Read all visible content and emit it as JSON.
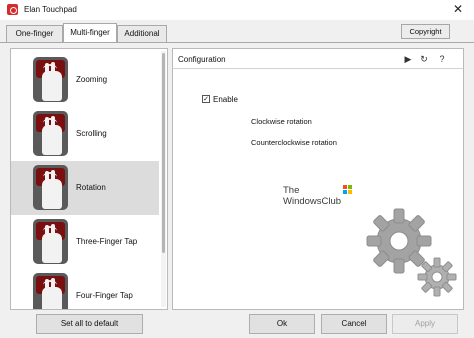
{
  "window": {
    "title": "Elan Touchpad",
    "close_glyph": "✕"
  },
  "tabs": [
    {
      "label": "One-finger",
      "active": false
    },
    {
      "label": "Multi-finger",
      "active": true
    },
    {
      "label": "Additional",
      "active": false
    }
  ],
  "copyright_label": "Copyright",
  "gestures": [
    {
      "label": "Zooming",
      "icon": "zoom-gesture-icon",
      "selected": false
    },
    {
      "label": "Scrolling",
      "icon": "scroll-gesture-icon",
      "selected": false
    },
    {
      "label": "Rotation",
      "icon": "rotation-gesture-icon",
      "selected": true
    },
    {
      "label": "Three-Finger Tap",
      "icon": "three-finger-tap-icon",
      "selected": false
    },
    {
      "label": "Four-Finger Tap",
      "icon": "four-finger-tap-icon",
      "selected": false
    }
  ],
  "configuration": {
    "title": "Configuration",
    "enable_label": "Enable",
    "enable_checked": true,
    "options": [
      "Clockwise rotation",
      "Counterclockwise rotation"
    ]
  },
  "watermark": {
    "line1": "The",
    "line2": "WindowsClub"
  },
  "buttons": {
    "set_default": "Set all to default",
    "ok": "Ok",
    "cancel": "Cancel",
    "apply": "Apply"
  },
  "colors": {
    "app_icon": "#d52b2b",
    "selected_item": "#dcdcdc",
    "gear": "#9a9a9a"
  }
}
